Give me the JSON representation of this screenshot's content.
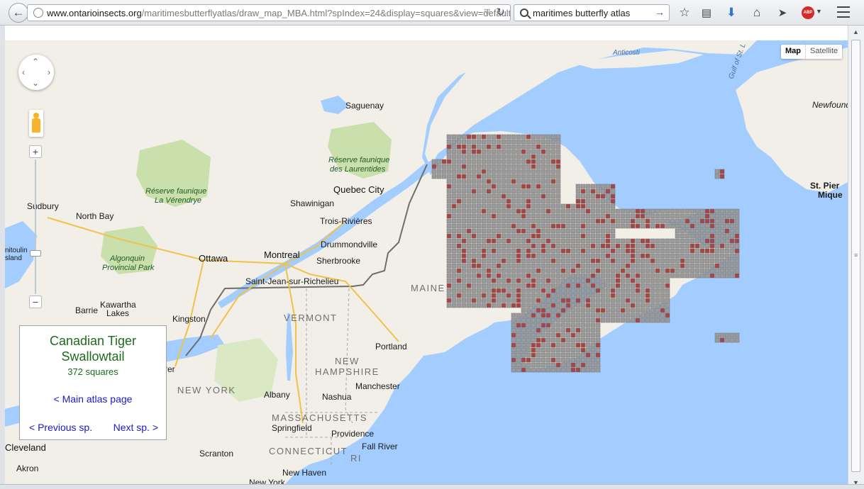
{
  "browser": {
    "url_domain": "www.ontarioinsects.org",
    "url_path": "/maritimesbutterflyatlas/draw_map_MBA.html?spIndex=24&display=squares&view=default",
    "search_text": "maritimes butterfly atlas",
    "abp_label": "ABP"
  },
  "map": {
    "type_buttons": {
      "map": "Map",
      "satellite": "Satellite"
    },
    "labels": {
      "anticosti": "Anticosti",
      "gulf": "Gulf of St. L",
      "newfound": "Newfound",
      "saguenay": "Saguenay",
      "reserve_laurentides_1": "Réserve faunique",
      "reserve_laurentides_2": "des Laurentides",
      "reserve_verendrye_1": "Réserve faunique",
      "reserve_verendrye_2": "La Vérendrye",
      "quebec_city": "Quebec City",
      "st_pierre_1": "St. Pier",
      "st_pierre_2": "Mique",
      "sudbury": "Sudbury",
      "north_bay": "North Bay",
      "shawinigan": "Shawinigan",
      "trois_rivieres": "Trois-Rivières",
      "drummondville": "Drummondville",
      "itoulin": "nitoulin",
      "sland": "sland",
      "algonquin_1": "Algonquin",
      "algonquin_2": "Provincial Park",
      "ottawa": "Ottawa",
      "montreal": "Montreal",
      "sherbrooke": "Sherbrooke",
      "saint_jean": "Saint-Jean-sur-Richelieu",
      "maine": "MAINE",
      "kawartha_1": "Kawartha",
      "kawartha_2": "Lakes",
      "barrie": "Barrie",
      "kingston": "Kingston",
      "vermont": "VERMONT",
      "portland": "Portland",
      "new_1": "NEW",
      "new_2": "HAMPSHIRE",
      "manchester": "Manchester",
      "new_york": "NEW YORK",
      "albany": "Albany",
      "nashua": "Nashua",
      "massachusetts": "MASSACHUSETTS",
      "springfield": "Springfield",
      "providence": "Providence",
      "connecticut": "CONNECTICUT",
      "fall_river": "Fall River",
      "ri": "RI",
      "scranton": "Scranton",
      "new_haven": "New Haven",
      "cleveland": "Cleveland",
      "akron": "Akron",
      "rer": "rer",
      "new_york_city": "New York"
    }
  },
  "panel": {
    "species_line1": "Canadian Tiger",
    "species_line2": "Swallowtail",
    "squares": "372 squares",
    "main_link": "< Main atlas page",
    "prev_link": "< Previous sp.",
    "next_link": "Next sp. >"
  },
  "colors": {
    "water": "#a3ccff",
    "land": "#f2efe9",
    "park": "#c9dfac",
    "grid_empty": "#9b9b9b",
    "grid_recorded": "#a94545",
    "panel_text": "#1c6b1c",
    "link": "#1a1ac8"
  }
}
